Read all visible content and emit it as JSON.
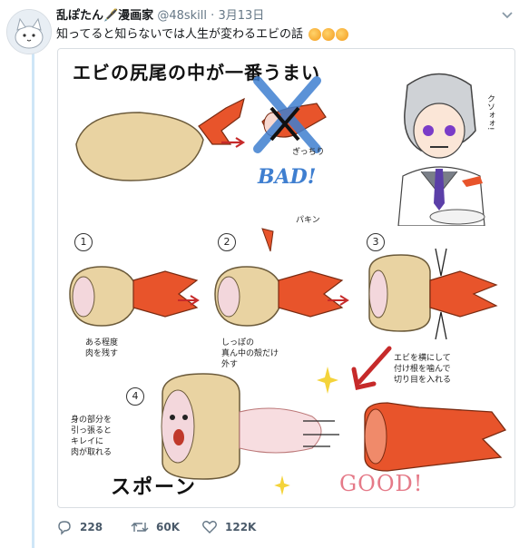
{
  "tweet": {
    "display_name": "乱ぽたん🖋️漫画家",
    "handle": "@48skill",
    "separator": "·",
    "date": "3月13日",
    "text": "知ってると知らないでは人生が変わるエビの話"
  },
  "image": {
    "title": "エビの尻尾の中が一番うまい",
    "bad_label": "BAD!",
    "bad_note": "ぎっちり",
    "snap_sfx": "パキン",
    "kuso_sfx": "クソォォ!",
    "good_label": "GOOD!",
    "spoon_label": "スポーン",
    "steps": [
      {
        "num": "1",
        "caption": "ある程度\n肉を残す"
      },
      {
        "num": "2",
        "caption": "しっぽの\n真ん中の殻だけ\n外す"
      },
      {
        "num": "3",
        "caption": "エビを横にして\n付け根を噛んで\n切り目を入れる"
      },
      {
        "num": "4",
        "caption": "身の部分を\n引っ張ると\nキレイに\n肉が取れる"
      }
    ]
  },
  "actions": {
    "reply_count": "228",
    "retweet_count": "60K",
    "like_count": "122K"
  },
  "colors": {
    "shrimp": "#e8542b",
    "batter": "#e9d3a2",
    "thread_line": "#cfe6f7",
    "muted": "#657786"
  }
}
